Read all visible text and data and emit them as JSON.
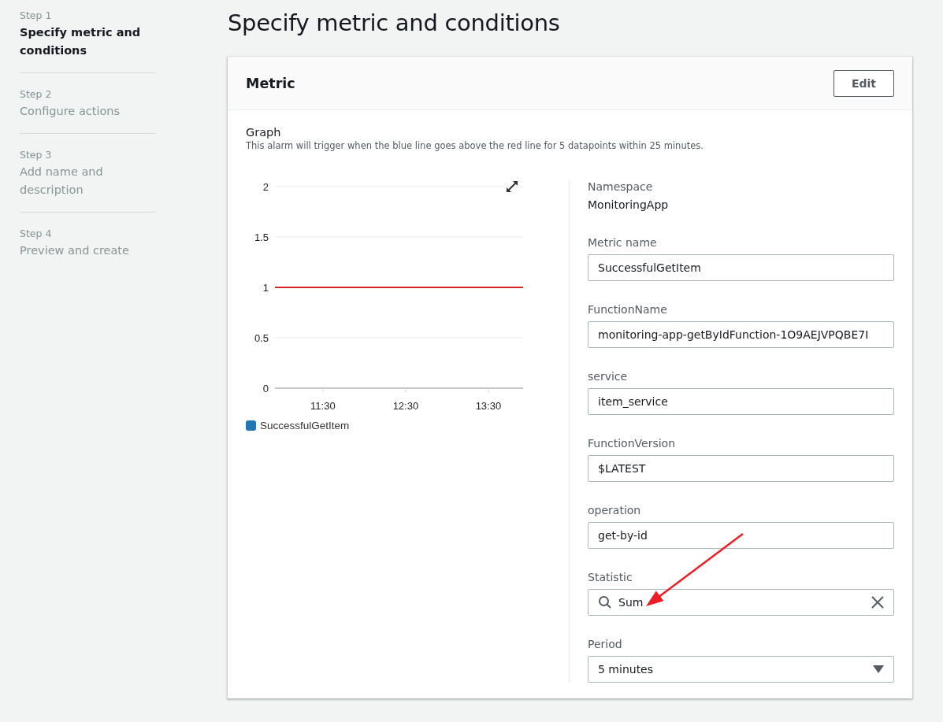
{
  "steps": [
    {
      "step": "Step 1",
      "label": "Specify metric and conditions",
      "selected": true
    },
    {
      "step": "Step 2",
      "label": "Configure actions",
      "selected": false
    },
    {
      "step": "Step 3",
      "label": "Add name and description",
      "selected": false
    },
    {
      "step": "Step 4",
      "label": "Preview and create",
      "selected": false
    }
  ],
  "page_title": "Specify metric and conditions",
  "metric_panel": {
    "title": "Metric",
    "edit_button": "Edit",
    "graph": {
      "title": "Graph",
      "description": "This alarm will trigger when the blue line goes above the red line for 5 datapoints within 25 minutes.",
      "chart_data": {
        "type": "line",
        "ylim": [
          0,
          2
        ],
        "categories": [
          "11:30",
          "12:30",
          "13:30"
        ],
        "yticks": [
          {
            "value": 0,
            "label": "0"
          },
          {
            "value": 0.5,
            "label": "0.5"
          },
          {
            "value": 1,
            "label": "1"
          },
          {
            "value": 1.5,
            "label": "1.5"
          },
          {
            "value": 2,
            "label": "2"
          }
        ],
        "series": [
          {
            "name": "SuccessfulGetItem",
            "color": "#1f77b4",
            "values": [
              null,
              null,
              null
            ]
          }
        ],
        "ref_lines": [
          {
            "axis": "y",
            "value": 1,
            "color": "#d62728"
          }
        ]
      }
    },
    "namespace": {
      "label": "Namespace",
      "value": "MonitoringApp"
    },
    "fields": [
      {
        "kind": "text",
        "label": "Metric name",
        "value": "SuccessfulGetItem"
      },
      {
        "kind": "text",
        "label": "FunctionName",
        "value": "monitoring-app-getByIdFunction-1O9AEJVPQBE7I"
      },
      {
        "kind": "text",
        "label": "service",
        "value": "item_service"
      },
      {
        "kind": "text",
        "label": "FunctionVersion",
        "value": "$LATEST"
      },
      {
        "kind": "text",
        "label": "operation",
        "value": "get-by-id"
      },
      {
        "kind": "search",
        "label": "Statistic",
        "value": "Sum"
      },
      {
        "kind": "select",
        "label": "Period",
        "value": "5 minutes"
      }
    ]
  }
}
